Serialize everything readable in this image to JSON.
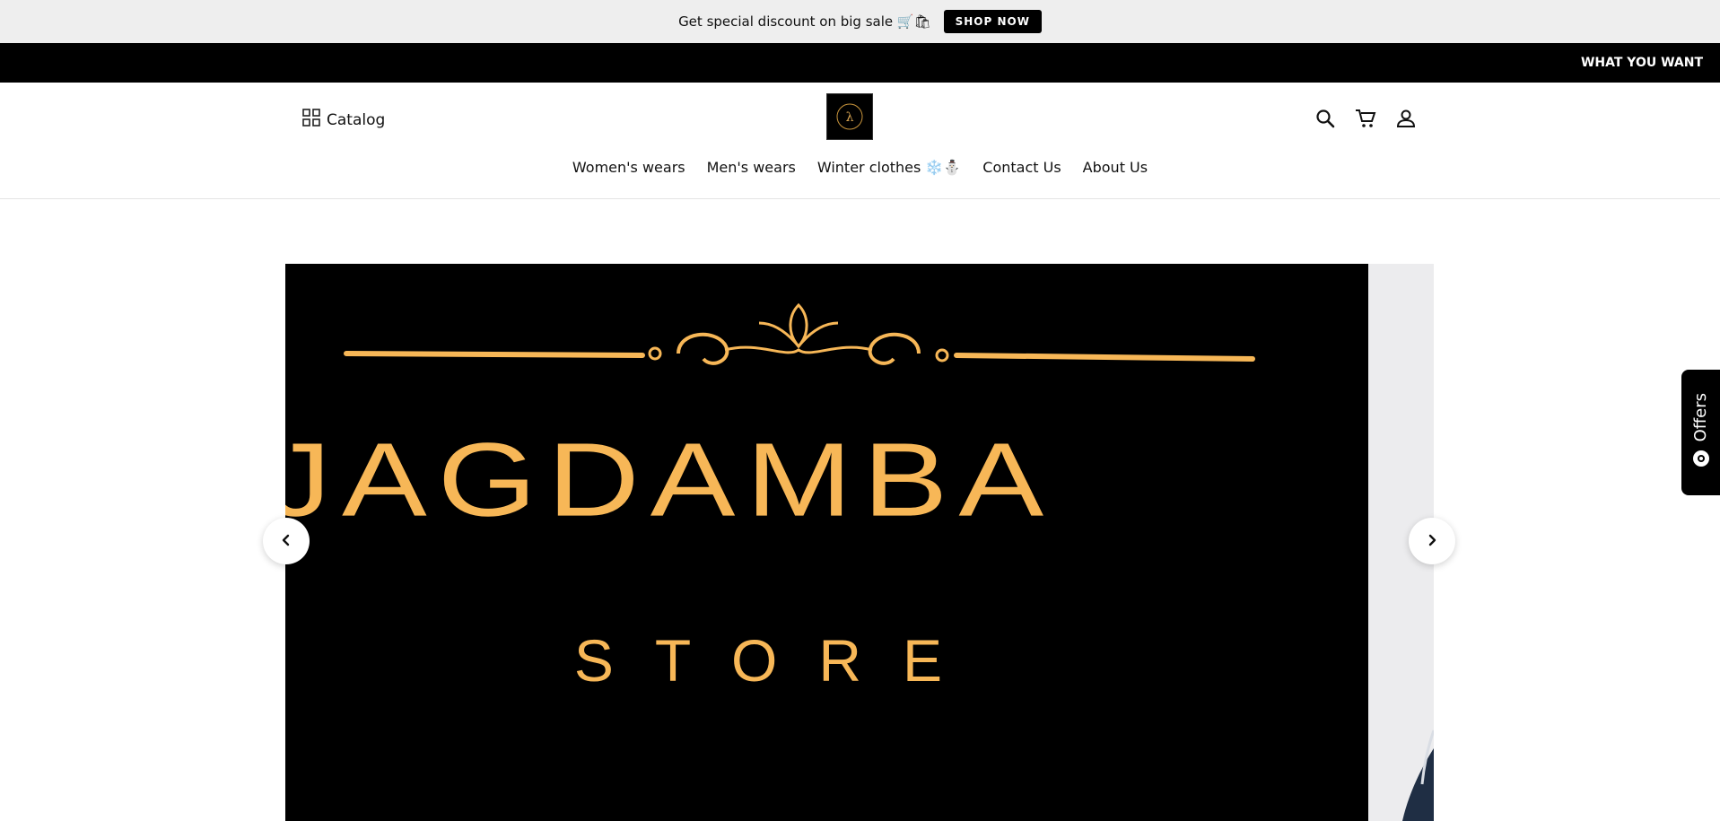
{
  "announcement": {
    "text": "Get special discount on big sale 🛒🛍",
    "button_label": "SHOP NOW"
  },
  "marquee": {
    "text": "WHAT YOU WANT"
  },
  "header": {
    "catalog_label": "Catalog",
    "logo_letter": "λ",
    "icons": [
      "search-icon",
      "cart-icon",
      "account-icon"
    ]
  },
  "nav": {
    "items": [
      {
        "label": "Women's wears"
      },
      {
        "label": "Men's wears"
      },
      {
        "label": "Winter clothes ❄️⛄"
      },
      {
        "label": "Contact Us"
      },
      {
        "label": "About Us"
      }
    ]
  },
  "banner": {
    "brand": "JAGDAMBA",
    "subtitle": "STORE",
    "colors": {
      "background": "#000000",
      "accent": "#f7b757"
    }
  },
  "offers_tab": {
    "label": "Offers",
    "icon": "gear-badge-icon"
  }
}
